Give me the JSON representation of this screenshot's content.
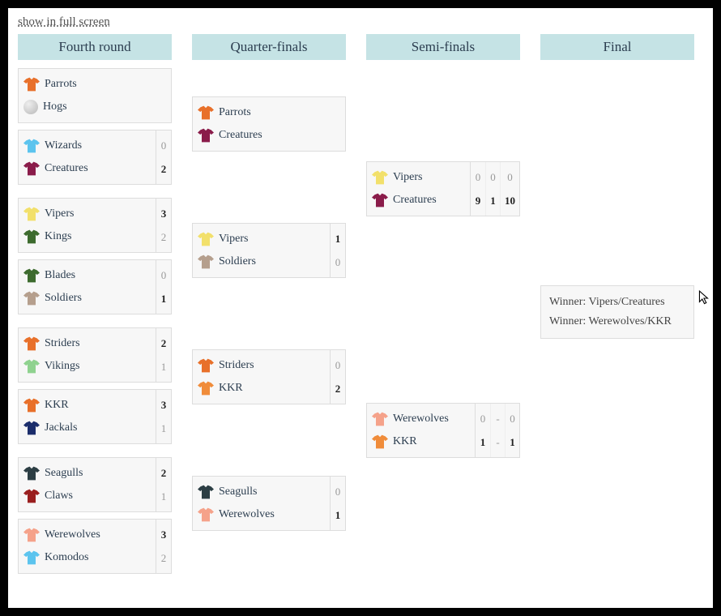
{
  "link_fullscreen": "show in full screen",
  "rounds": {
    "r1": "Fourth round",
    "r2": "Quarter-finals",
    "r3": "Semi-finals",
    "r4": "Final"
  },
  "colors": {
    "orange": "#e8702a",
    "maroon": "#8a1c4a",
    "skyblue": "#5cc4ee",
    "yellow": "#f2e06b",
    "darkgreen": "#3d6b2e",
    "tan": "#b59f8d",
    "lightgreen": "#8fd28f",
    "navy": "#1b2d6b",
    "darkslate": "#2c3e44",
    "darkred": "#9a1f1f",
    "salmon": "#f5a28a",
    "orange2": "#f08c3a"
  },
  "r1": [
    {
      "a": {
        "n": "Parrots",
        "c": "orange"
      },
      "b": {
        "n": "Hogs",
        "ball": true
      },
      "scores": []
    },
    {
      "a": {
        "n": "Wizards",
        "c": "skyblue"
      },
      "b": {
        "n": "Creatures",
        "c": "maroon"
      },
      "scores": [
        [
          "0",
          "2"
        ]
      ]
    },
    {
      "a": {
        "n": "Vipers",
        "c": "yellow"
      },
      "b": {
        "n": "Kings",
        "c": "darkgreen"
      },
      "scores": [
        [
          "3",
          "2"
        ]
      ]
    },
    {
      "a": {
        "n": "Blades",
        "c": "darkgreen"
      },
      "b": {
        "n": "Soldiers",
        "c": "tan"
      },
      "scores": [
        [
          "0",
          "1"
        ]
      ]
    },
    {
      "a": {
        "n": "Striders",
        "c": "orange"
      },
      "b": {
        "n": "Vikings",
        "c": "lightgreen"
      },
      "scores": [
        [
          "2",
          "1"
        ]
      ]
    },
    {
      "a": {
        "n": "KKR",
        "c": "orange"
      },
      "b": {
        "n": "Jackals",
        "c": "navy"
      },
      "scores": [
        [
          "3",
          "1"
        ]
      ]
    },
    {
      "a": {
        "n": "Seagulls",
        "c": "darkslate"
      },
      "b": {
        "n": "Claws",
        "c": "darkred"
      },
      "scores": [
        [
          "2",
          "1"
        ]
      ]
    },
    {
      "a": {
        "n": "Werewolves",
        "c": "salmon"
      },
      "b": {
        "n": "Komodos",
        "c": "skyblue"
      },
      "scores": [
        [
          "3",
          "2"
        ]
      ]
    }
  ],
  "r2": [
    {
      "a": {
        "n": "Parrots",
        "c": "orange"
      },
      "b": {
        "n": "Creatures",
        "c": "maroon"
      },
      "scores": []
    },
    {
      "a": {
        "n": "Vipers",
        "c": "yellow"
      },
      "b": {
        "n": "Soldiers",
        "c": "tan"
      },
      "scores": [
        [
          "1",
          "0"
        ]
      ]
    },
    {
      "a": {
        "n": "Striders",
        "c": "orange"
      },
      "b": {
        "n": "KKR",
        "c": "orange2"
      },
      "scores": [
        [
          "0",
          "2"
        ]
      ]
    },
    {
      "a": {
        "n": "Seagulls",
        "c": "darkslate"
      },
      "b": {
        "n": "Werewolves",
        "c": "salmon"
      },
      "scores": [
        [
          "0",
          "1"
        ]
      ]
    }
  ],
  "r3": [
    {
      "a": {
        "n": "Vipers",
        "c": "yellow"
      },
      "b": {
        "n": "Creatures",
        "c": "maroon"
      },
      "scores": [
        [
          "0",
          "9"
        ],
        [
          "0",
          "1"
        ],
        [
          "0",
          "10"
        ]
      ]
    },
    {
      "a": {
        "n": "Werewolves",
        "c": "salmon"
      },
      "b": {
        "n": "KKR",
        "c": "orange2"
      },
      "scores": [
        [
          "0",
          "1"
        ],
        [
          "-",
          "-"
        ],
        [
          "0",
          "1"
        ]
      ]
    }
  ],
  "final": {
    "line1": "Winner: Vipers/Creatures",
    "line2": "Winner: Werewolves/KKR"
  }
}
